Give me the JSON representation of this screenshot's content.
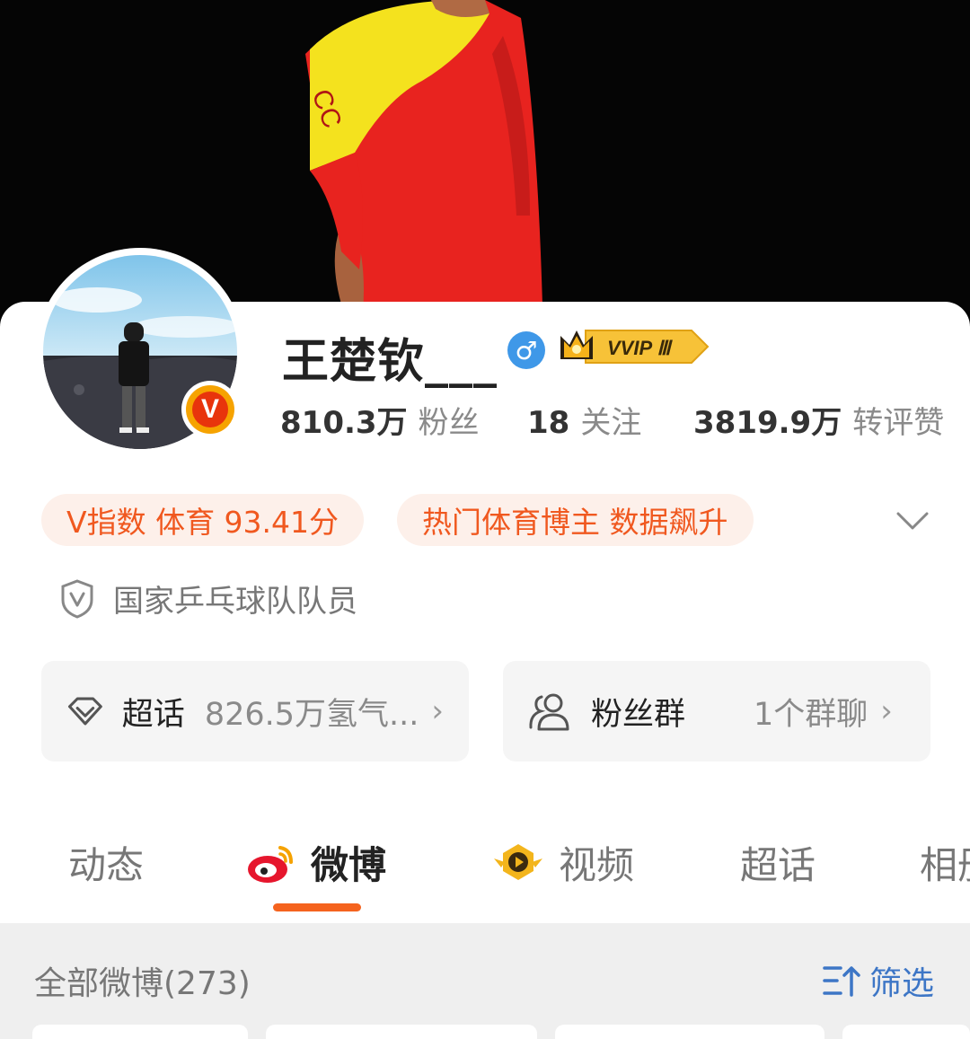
{
  "profile": {
    "name": "王楚钦___",
    "gender_symbol": "♂",
    "vip_badge": "VVIP Ⅲ",
    "verified_badge": "V"
  },
  "stats": [
    {
      "value": "810.3万",
      "label": "粉丝"
    },
    {
      "value": "18",
      "label": "关注"
    },
    {
      "value": "3819.9万",
      "label": "转评赞"
    }
  ],
  "tags": [
    {
      "text": "V指数 体育 93.41分"
    },
    {
      "text": "热门体育博主 数据飙升"
    }
  ],
  "verification": {
    "text": "国家乒乓球队队员"
  },
  "supertopic": {
    "label": "超话",
    "value": "826.5万氢气...",
    "chevron": "›"
  },
  "fangroup": {
    "label": "粉丝群",
    "value": "1个群聊",
    "chevron": "›"
  },
  "tabs": [
    {
      "label": "动态"
    },
    {
      "label": "微博"
    },
    {
      "label": "视频"
    },
    {
      "label": "超话"
    },
    {
      "label": "相册"
    }
  ],
  "feed": {
    "all_label": "全部微博(273)",
    "filter_label": "筛选"
  },
  "colors": {
    "accent": "#f5631e",
    "tag_text": "#f0581f",
    "tag_bg": "#fdf0ea",
    "link_blue": "#3d76c6",
    "gender_blue": "#3f98e8"
  },
  "icons": [
    "supertopic-diamond-icon",
    "fan-group-people-icon",
    "shield-v-icon",
    "chevron-down-icon",
    "weibo-logo-icon",
    "video-play-icon",
    "filter-icon"
  ]
}
